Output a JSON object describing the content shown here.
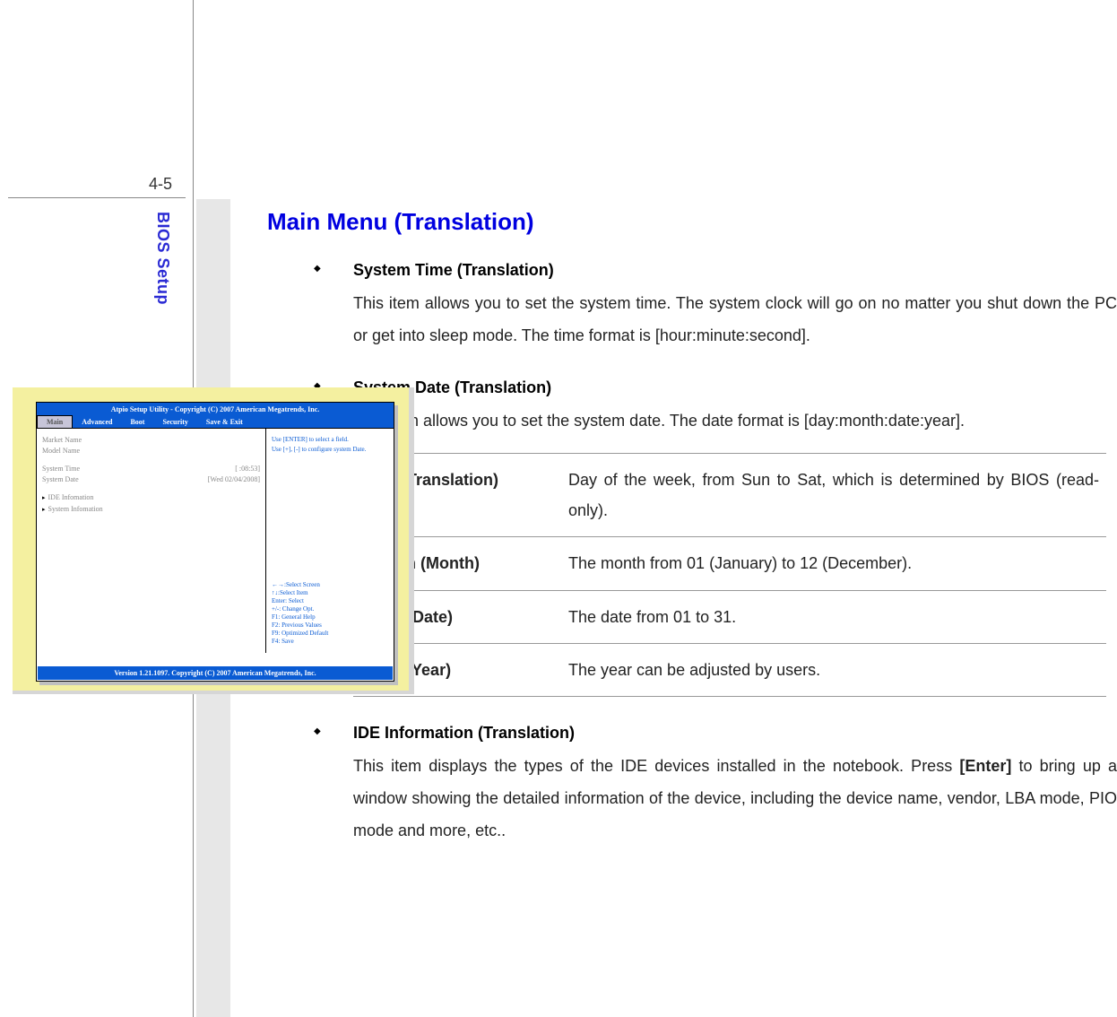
{
  "page_number": "4-5",
  "sidebar_title": "BIOS Setup",
  "main_title": "Main Menu (Translation)",
  "items": [
    {
      "head": "System Time (Translation)",
      "body": "This item allows you to set the system time.  The system clock will go on no matter you shut down the PC or get into sleep mode.  The time format is [hour:minute:second]."
    },
    {
      "head": "System Date (Translation)",
      "body": "This item allows you to set the system date.   The date format is [day:month:date:year]."
    },
    {
      "head": "IDE Information (Translation)",
      "body_pre": "This item displays the types of the IDE devices installed in the notebook. Press ",
      "body_bold": "[Enter]",
      "body_post": " to bring up a window showing the detailed information of the device, including the device name, vendor, LBA mode, PIO mode and more, etc.."
    }
  ],
  "date_table": [
    {
      "key": "Day (Translation)",
      "val": "Day of the week, from Sun to Sat, which is determined by BIOS (read-only)."
    },
    {
      "key": "Month (Month)",
      "val": "The month from 01 (January) to 12 (December)."
    },
    {
      "key": "Date (Date)",
      "val": "The date from 01 to 31."
    },
    {
      "key": "Year (Year)",
      "val": "The year can be adjusted by users."
    }
  ],
  "bios": {
    "header": "Atpio Setup Utility - Copyright (C) 2007 American Megatrends, Inc.",
    "tabs": [
      "Main",
      "Advanced",
      "Boot",
      "Security",
      "Save & Exit"
    ],
    "left": {
      "market": "Market Name",
      "model": "Model Name",
      "time_label": "System Time",
      "time_val": "[   :08:53]",
      "date_label": "System Date",
      "date_val": "[Wed 02/04/2008]",
      "ide": "IDE Infomation",
      "sys": "System Infomation"
    },
    "right_top": [
      "Use [ENTER] to select a field.",
      "Use [+], [-] to configure system Date."
    ],
    "right_bot": [
      "←→:Select Screen",
      "↑↓:Select Item",
      "Enter: Select",
      "+/-:  Change Opt.",
      "F1:  General Help",
      "F2:  Previous Values",
      "F9:  Optimized Default",
      "F4:  Save"
    ],
    "footer": "Version 1.21.1097. Copyright (C) 2007 American Megatrends, Inc."
  }
}
